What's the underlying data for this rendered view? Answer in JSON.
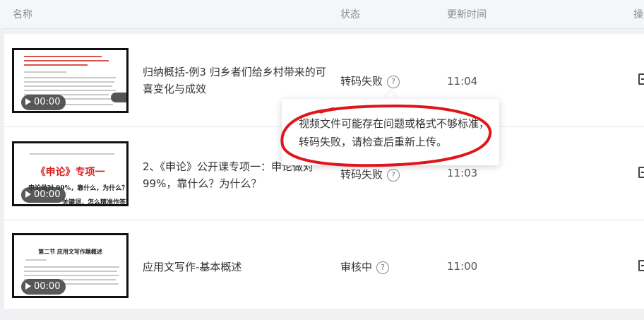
{
  "header": {
    "col_name": "名称",
    "col_status": "状态",
    "col_updated": "更新时间",
    "col_ops": "操"
  },
  "rows": [
    {
      "title": "归纳概括-例3  归乡者们给乡村带来的可喜变化与成效",
      "duration": "00:00",
      "status": "转码失败",
      "time": "11:04"
    },
    {
      "title": "2、《申论》公开课专项一：申论做对99%，靠什么？为什么？",
      "duration": "00:00",
      "status": "转码失败",
      "time": "11:03",
      "thumb_heading": "《申论》专项一",
      "thumb_line1": "申论做对 99%，靠什么，为什么？",
      "thumb_line2": "关键词，怎么精准作答？"
    },
    {
      "title": "应用文写作-基本概述",
      "duration": "00:00",
      "status": "审核中",
      "time": "11:00",
      "thumb_doc_title": "第二节  应用文写作题概述"
    }
  ],
  "tooltip": {
    "line1": "视频文件可能存在问题或格式不够标准，",
    "line2": "转码失败，请检查后重新上传。"
  },
  "help_glyph": "?",
  "colors": {
    "annotation_red": "#e0151b",
    "thumb_red": "#d9231f"
  }
}
